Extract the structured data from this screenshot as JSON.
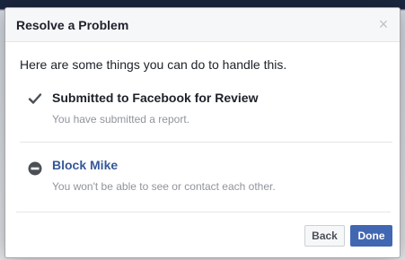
{
  "dialog": {
    "title": "Resolve a Problem",
    "close_icon": "close-icon",
    "intro": "Here are some things you can do to handle this."
  },
  "options": [
    {
      "icon": "checkmark-icon",
      "title": "Submitted to Facebook for Review",
      "subtitle": "You have submitted a report."
    },
    {
      "icon": "block-icon",
      "title": "Block Mike",
      "subtitle": "You won't be able to see or contact each other."
    }
  ],
  "buttons": {
    "back": "Back",
    "done": "Done"
  },
  "colors": {
    "link": "#365899",
    "primary_button": "#4267b2",
    "muted_text": "#90949c"
  }
}
